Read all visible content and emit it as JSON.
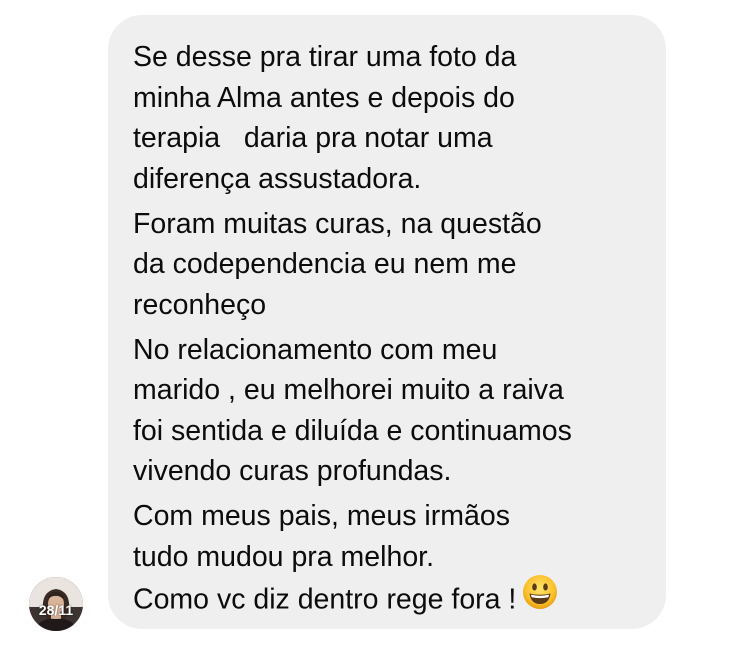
{
  "message": {
    "paragraphs": [
      {
        "lines": [
          "Se desse pra tirar uma foto da",
          "minha Alma antes e depois do",
          "terapia   daria pra notar uma",
          "diferença assustadora."
        ]
      },
      {
        "lines": [
          "Foram muitas curas, na questão",
          "da codependencia eu nem me",
          "reconheço"
        ]
      },
      {
        "lines": [
          "No relacionamento com meu",
          "marido , eu melhorei muito a raiva",
          "foi sentida e diluída e continuamos",
          "vivendo curas profundas."
        ]
      },
      {
        "lines": [
          "Com meus pais, meus irmãos",
          "tudo mudou pra melhor.",
          "Como vc diz dentro rege fora !"
        ]
      }
    ],
    "emoji_icon": "grinning-face-emoji",
    "bubble_color": "#efeff0",
    "text_color": "#0c0c0c"
  },
  "avatar": {
    "date_label": "28/11"
  }
}
